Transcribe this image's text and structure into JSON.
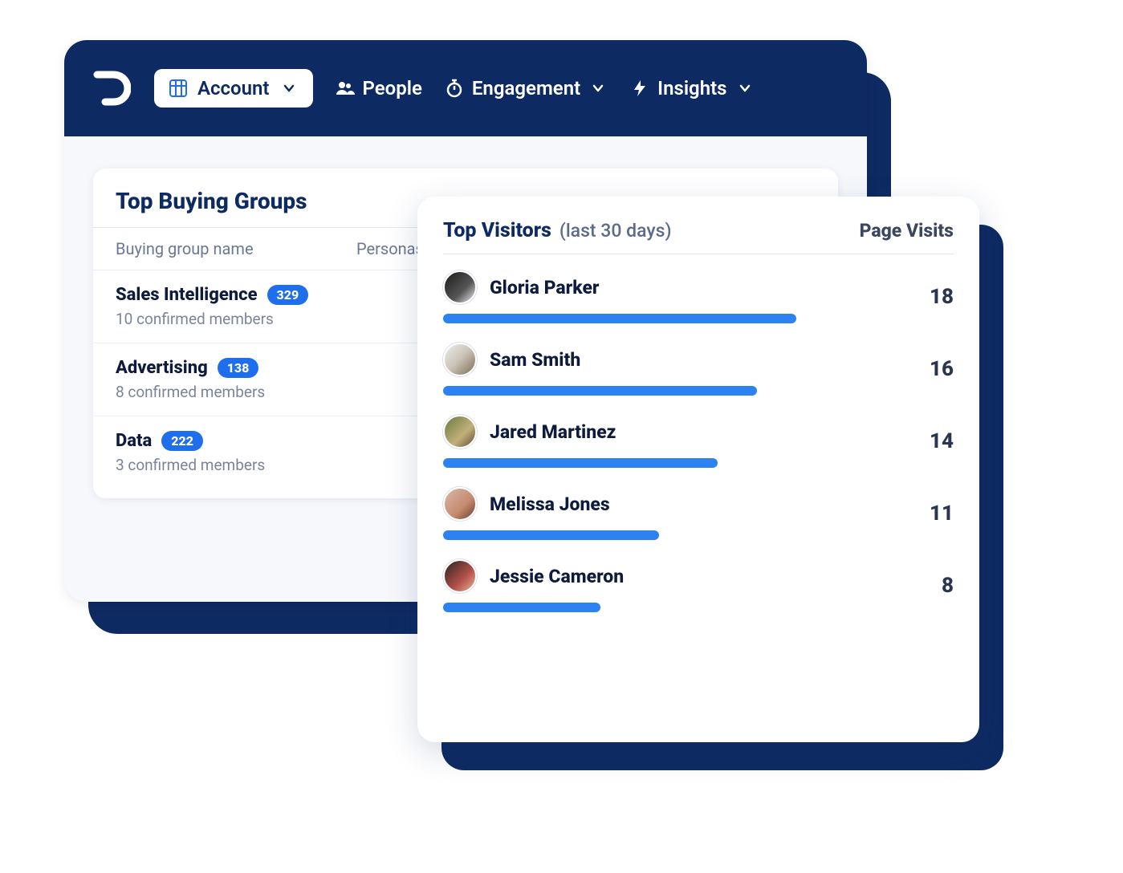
{
  "nav": {
    "account_label": "Account",
    "people_label": "People",
    "engagement_label": "Engagement",
    "insights_label": "Insights"
  },
  "buying_groups": {
    "title": "Top Buying Groups",
    "col_name": "Buying group name",
    "col_personas": "Personas",
    "rows": [
      {
        "name": "Sales Intelligence",
        "count": "329",
        "members": "10 confirmed members"
      },
      {
        "name": "Advertising",
        "count": "138",
        "members": "8 confirmed members"
      },
      {
        "name": "Data",
        "count": "222",
        "members": "3 confirmed members"
      }
    ]
  },
  "visitors": {
    "title": "Top Visitors",
    "subtitle": "(last 30 days)",
    "right_label": "Page Visits",
    "max": 18,
    "rows": [
      {
        "name": "Gloria Parker",
        "visits": 18
      },
      {
        "name": "Sam Smith",
        "visits": 16
      },
      {
        "name": "Jared Martinez",
        "visits": 14
      },
      {
        "name": "Melissa Jones",
        "visits": 11
      },
      {
        "name": "Jessie Cameron",
        "visits": 8
      }
    ]
  },
  "chart_data": {
    "type": "bar",
    "title": "Top Visitors (last 30 days) — Page Visits",
    "categories": [
      "Gloria Parker",
      "Sam Smith",
      "Jared Martinez",
      "Melissa Jones",
      "Jessie Cameron"
    ],
    "values": [
      18,
      16,
      14,
      11,
      8
    ],
    "xlabel": "Page Visits",
    "ylabel": "",
    "ylim": [
      0,
      18
    ]
  }
}
